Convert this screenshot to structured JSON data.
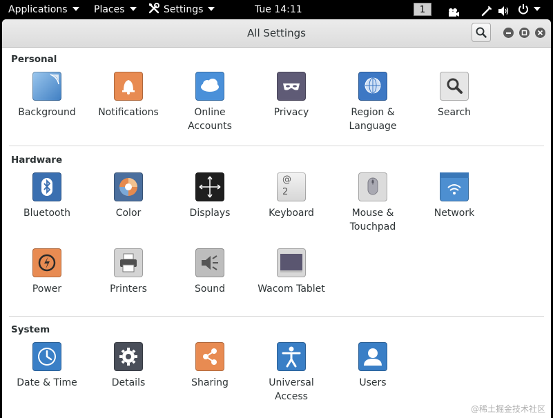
{
  "topbar": {
    "applications": "Applications",
    "places": "Places",
    "settings": "Settings",
    "clock": "Tue 14:11",
    "workspace": "1"
  },
  "window": {
    "title": "All Settings"
  },
  "sections": {
    "personal": {
      "title": "Personal",
      "items": [
        {
          "label": "Background",
          "icon": "background-icon"
        },
        {
          "label": "Notifications",
          "icon": "bell-icon"
        },
        {
          "label": "Online\nAccounts",
          "icon": "cloud-icon"
        },
        {
          "label": "Privacy",
          "icon": "mask-icon"
        },
        {
          "label": "Region &\nLanguage",
          "icon": "globe-icon"
        },
        {
          "label": "Search",
          "icon": "magnifier-icon"
        }
      ]
    },
    "hardware": {
      "title": "Hardware",
      "items": [
        {
          "label": "Bluetooth",
          "icon": "bluetooth-icon"
        },
        {
          "label": "Color",
          "icon": "color-icon"
        },
        {
          "label": "Displays",
          "icon": "display-icon"
        },
        {
          "label": "Keyboard",
          "icon": "keyboard-icon"
        },
        {
          "label": "Mouse &\nTouchpad",
          "icon": "mouse-icon"
        },
        {
          "label": "Network",
          "icon": "network-icon"
        },
        {
          "label": "Power",
          "icon": "power-icon"
        },
        {
          "label": "Printers",
          "icon": "printer-icon"
        },
        {
          "label": "Sound",
          "icon": "speaker-icon"
        },
        {
          "label": "Wacom Tablet",
          "icon": "tablet-icon"
        }
      ]
    },
    "system": {
      "title": "System",
      "items": [
        {
          "label": "Date & Time",
          "icon": "clock-icon"
        },
        {
          "label": "Details",
          "icon": "gear-icon"
        },
        {
          "label": "Sharing",
          "icon": "share-icon"
        },
        {
          "label": "Universal\nAccess",
          "icon": "accessibility-icon"
        },
        {
          "label": "Users",
          "icon": "user-icon"
        }
      ]
    }
  },
  "keyboard_glyphs": {
    "top": "@",
    "bottom": "2"
  },
  "watermark": "@稀土掘金技术社区"
}
